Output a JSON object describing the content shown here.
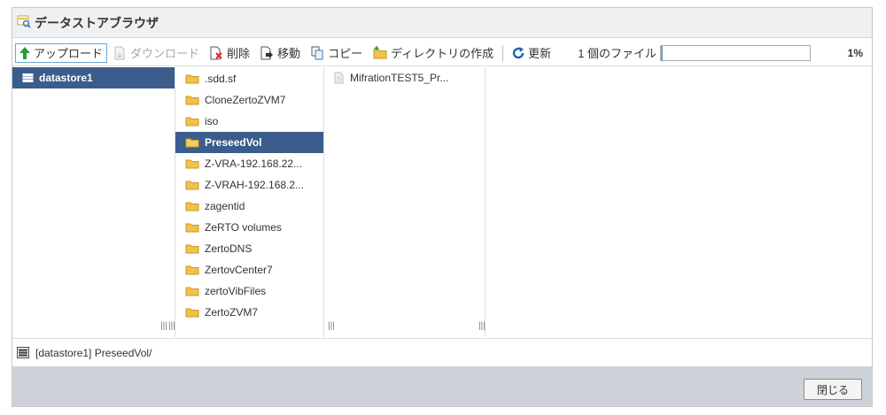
{
  "window": {
    "title": "データストアブラウザ",
    "title_icon": "datastore-browser-icon"
  },
  "toolbar": {
    "upload": "アップロード",
    "download": "ダウンロード",
    "delete": "削除",
    "move": "移動",
    "copy": "コピー",
    "mkdir": "ディレクトリの作成",
    "refresh": "更新",
    "file_count": "1 個のファイル",
    "progress_percent": 1,
    "progress_label": "1%"
  },
  "panes": {
    "datastores": [
      {
        "label": "datastore1",
        "selected": true
      }
    ],
    "folders": [
      {
        "label": ".sdd.sf"
      },
      {
        "label": "CloneZertoZVM7"
      },
      {
        "label": "iso"
      },
      {
        "label": "PreseedVol",
        "selected": true
      },
      {
        "label": "Z-VRA-192.168.22..."
      },
      {
        "label": "Z-VRAH-192.168.2..."
      },
      {
        "label": "zagentid"
      },
      {
        "label": "ZeRTO volumes"
      },
      {
        "label": "ZertoDNS"
      },
      {
        "label": "ZertovCenter7"
      },
      {
        "label": "zertoVibFiles"
      },
      {
        "label": "ZertoZVM7"
      }
    ],
    "files": [
      {
        "label": "MifrationTEST5_Pr..."
      }
    ]
  },
  "path": "[datastore1] PreseedVol/",
  "footer": {
    "close": "閉じる"
  },
  "colors": {
    "selection": "#3a5d8b",
    "folder": "#f0c24a",
    "accent": "#2a9a3a"
  }
}
